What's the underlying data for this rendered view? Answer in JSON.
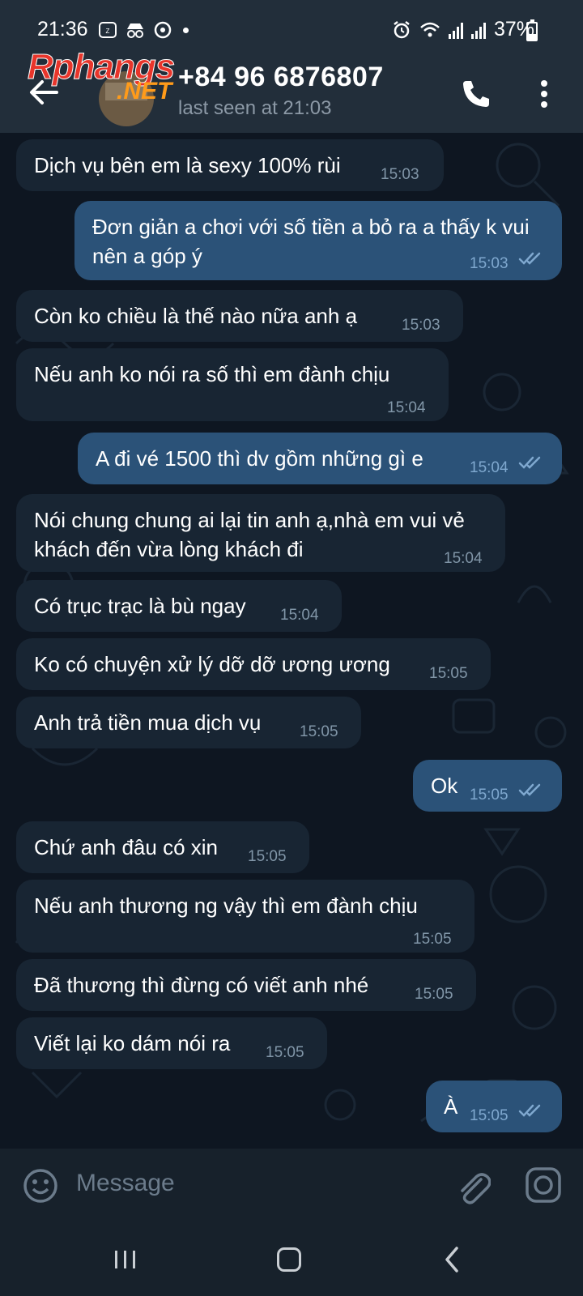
{
  "status_bar": {
    "time": "21:36",
    "left_icons": [
      "zalo-icon",
      "incognito-icon",
      "whatsapp-business-icon",
      "dot-icon"
    ],
    "right_icons": [
      "alarm-icon",
      "wifi-icon",
      "signal-icon",
      "signal-icon",
      "battery-icon"
    ],
    "battery": "37%",
    "battery_level": 0.37
  },
  "header": {
    "contact_name": "+84 96 6876807",
    "last_seen": "last seen at 21:03",
    "watermark_top": "Rphangs",
    "watermark_bottom": ".NET"
  },
  "messages": [
    {
      "dir": "in",
      "text": "Dịch vụ bên em là sexy 100% rùi",
      "time": "15:03"
    },
    {
      "dir": "out",
      "text": "Đơn giản a chơi với số tiền a bỏ ra a thấy k vui nên a góp ý",
      "time": "15:03",
      "read": true
    },
    {
      "dir": "in",
      "text": "Còn ko chiều là thế nào nữa anh ạ",
      "time": "15:03"
    },
    {
      "dir": "in",
      "text": "Nếu anh ko nói ra số thì em đành chịu",
      "time": "15:04"
    },
    {
      "dir": "out",
      "text": "A đi vé 1500 thì dv gồm những gì e",
      "time": "15:04",
      "read": true
    },
    {
      "dir": "in",
      "text": "Nói chung chung ai lại tin anh ạ,nhà em vui vẻ khách đến vừa lòng khách đi",
      "time": "15:04"
    },
    {
      "dir": "in",
      "text": "Có trục trạc là bù ngay",
      "time": "15:04"
    },
    {
      "dir": "in",
      "text": "Ko có chuyện xử lý dỡ dỡ ương ương",
      "time": "15:05"
    },
    {
      "dir": "in",
      "text": "Anh trả tiền mua dịch vụ",
      "time": "15:05"
    },
    {
      "dir": "out",
      "text": "Ok",
      "time": "15:05",
      "read": true
    },
    {
      "dir": "in",
      "text": "Chứ anh đâu có xin",
      "time": "15:05"
    },
    {
      "dir": "in",
      "text": "Nếu anh thương ng vậy thì em đành chịu",
      "time": "15:05"
    },
    {
      "dir": "in",
      "text": "Đã thương thì đừng có viết anh nhé",
      "time": "15:05"
    },
    {
      "dir": "in",
      "text": "Viết lại ko dám nói ra",
      "time": "15:05"
    },
    {
      "dir": "out",
      "text": "À",
      "time": "15:05",
      "read": true
    }
  ],
  "input": {
    "placeholder": "Message"
  },
  "colors": {
    "background": "#0e1621",
    "incoming_bubble": "#182533",
    "outgoing_bubble": "#2b5278",
    "header": "#222e3a"
  }
}
